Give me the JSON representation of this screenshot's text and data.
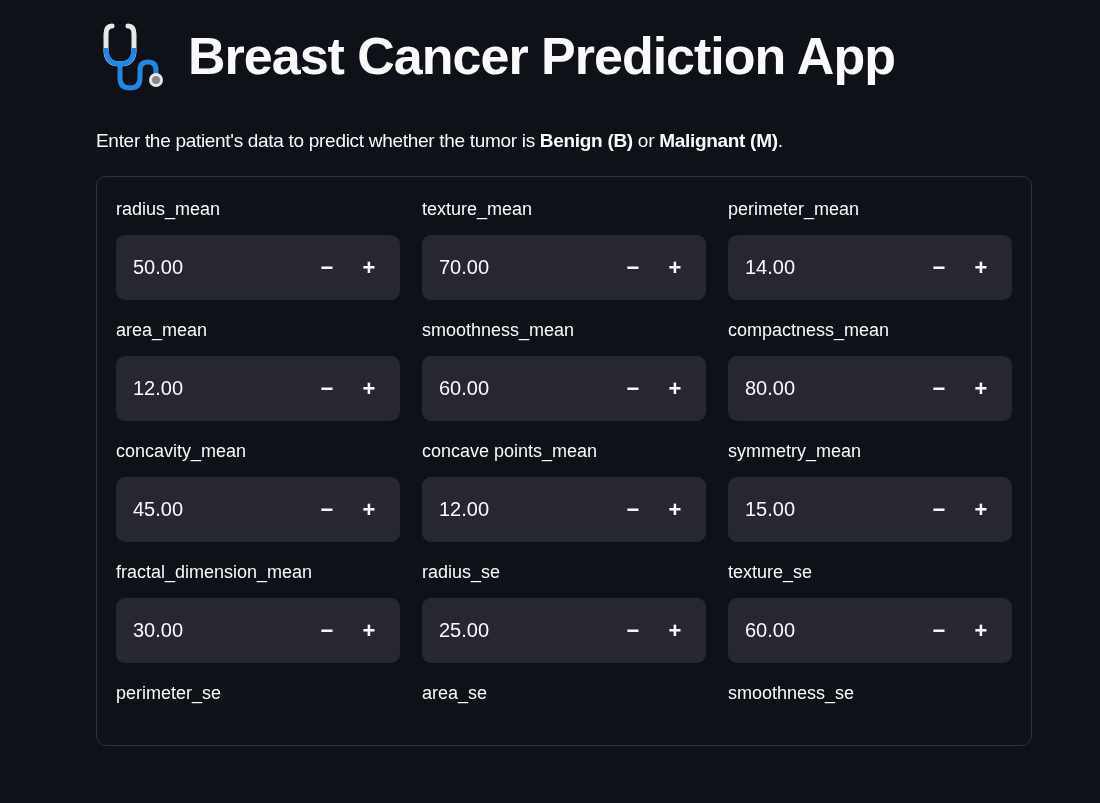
{
  "header": {
    "title": "Breast Cancer Prediction App"
  },
  "intro": "Enter the patient's data to predict whether the tumor is **Benign (B)** or **Malignant (M)**.",
  "fields": [
    {
      "label": "radius_mean",
      "value": "50.00",
      "minus": "−",
      "plus": "+"
    },
    {
      "label": "texture_mean",
      "value": "70.00",
      "minus": "−",
      "plus": "+"
    },
    {
      "label": "perimeter_mean",
      "value": "14.00",
      "minus": "−",
      "plus": "+"
    },
    {
      "label": "area_mean",
      "value": "12.00",
      "minus": "−",
      "plus": "+"
    },
    {
      "label": "smoothness_mean",
      "value": "60.00",
      "minus": "−",
      "plus": "+"
    },
    {
      "label": "compactness_mean",
      "value": "80.00",
      "minus": "−",
      "plus": "+"
    },
    {
      "label": "concavity_mean",
      "value": "45.00",
      "minus": "−",
      "plus": "+"
    },
    {
      "label": "concave points_mean",
      "value": "12.00",
      "minus": "−",
      "plus": "+"
    },
    {
      "label": "symmetry_mean",
      "value": "15.00",
      "minus": "−",
      "plus": "+"
    },
    {
      "label": "fractal_dimension_mean",
      "value": "30.00",
      "minus": "−",
      "plus": "+"
    },
    {
      "label": "radius_se",
      "value": "25.00",
      "minus": "−",
      "plus": "+"
    },
    {
      "label": "texture_se",
      "value": "60.00",
      "minus": "−",
      "plus": "+"
    },
    {
      "label": "perimeter_se"
    },
    {
      "label": "area_se"
    },
    {
      "label": "smoothness_se"
    }
  ]
}
